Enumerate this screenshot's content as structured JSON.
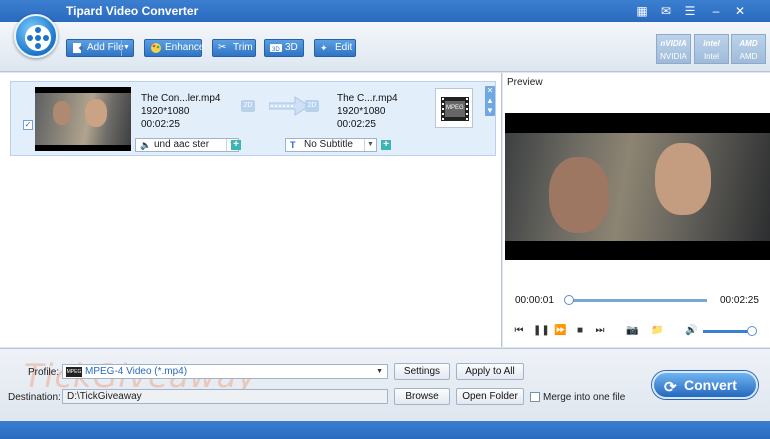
{
  "window": {
    "title": "Tipard Video Converter",
    "controls": [
      "gift-icon",
      "feedback-icon",
      "menu-icon",
      "minimize-icon",
      "close-icon"
    ]
  },
  "toolbar": {
    "add_file": "Add File",
    "enhance": "Enhance",
    "trim": "Trim",
    "three_d": "3D",
    "edit": "Edit",
    "accel": [
      {
        "logo": "nVIDIA",
        "label": "NVIDIA"
      },
      {
        "logo": "intel",
        "label": "Intel"
      },
      {
        "logo": "AMD",
        "label": "AMD"
      }
    ]
  },
  "file": {
    "src_name": "The Con...ler.mp4",
    "src_res": "1920*1080",
    "src_dur": "00:02:25",
    "dst_name": "The C...r.mp4",
    "dst_res": "1920*1080",
    "dst_dur": "00:02:25",
    "badge_src": "2D",
    "badge_dst": "2D",
    "audio": "und aac ster",
    "subtitle": "No Subtitle",
    "output_format_tag": "MPEG"
  },
  "preview": {
    "label": "Preview",
    "time_current": "00:00:01",
    "time_total": "00:02:25"
  },
  "bottom": {
    "profile_label": "Profile:",
    "profile_value": "MPEG-4 Video (*.mp4)",
    "profile_tag": "MPEG",
    "settings": "Settings",
    "apply_all": "Apply to All",
    "dest_label": "Destination:",
    "dest_value": "D:\\TickGiveaway",
    "browse": "Browse",
    "open_folder": "Open Folder",
    "merge": "Merge into one file",
    "convert": "Convert",
    "watermark": "TickGiveaway"
  },
  "colors": {
    "accent": "#2a6abf",
    "row_bg": "#e2eefa"
  }
}
